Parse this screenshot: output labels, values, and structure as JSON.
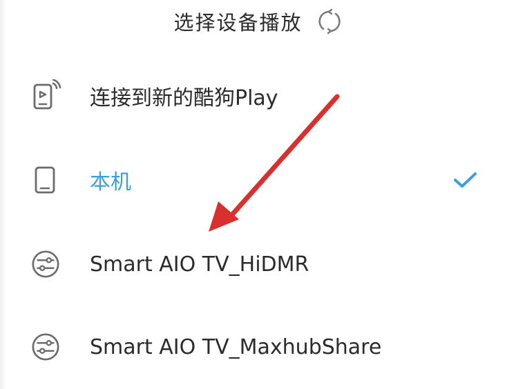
{
  "header": {
    "title": "选择设备播放",
    "refresh_icon": "refresh-icon"
  },
  "devices": [
    {
      "label": "连接到新的酷狗Play",
      "icon": "cast-phone-icon",
      "selected": false
    },
    {
      "label": "本机",
      "icon": "phone-icon",
      "selected": true
    },
    {
      "label": "Smart AIO TV_HiDMR",
      "icon": "dlna-device-icon",
      "selected": false
    },
    {
      "label": "Smart AIO TV_MaxhubShare",
      "icon": "dlna-device-icon",
      "selected": false
    }
  ],
  "colors": {
    "text": "#2b2b2b",
    "selected": "#3b9ede",
    "check": "#3b9ede",
    "icon": "#6b6b6b",
    "annotation_arrow": "#d9302f"
  }
}
